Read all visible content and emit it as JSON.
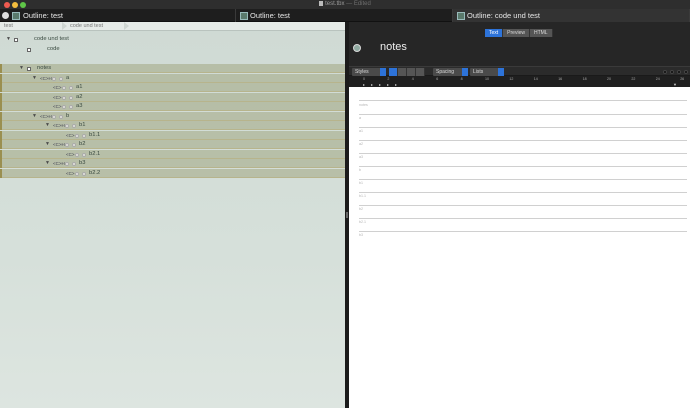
{
  "window": {
    "filename": "test.tbx",
    "status": "— Edited"
  },
  "tabs": [
    {
      "label": "Outline: test"
    },
    {
      "label": "Outline: test"
    },
    {
      "label": "Outline: code und test"
    }
  ],
  "breadcrumb": [
    "test",
    "code und test"
  ],
  "outline": [
    {
      "label": "code und test",
      "level": 0,
      "selected": false,
      "expanded": true,
      "tag": ""
    },
    {
      "label": "code",
      "level": 1,
      "selected": false,
      "expanded": false,
      "tag": ""
    },
    {
      "label": "notes",
      "level": 1,
      "selected": true,
      "expanded": true,
      "tag": ""
    },
    {
      "label": "a",
      "level": 2,
      "selected": true,
      "expanded": true,
      "tag": "<C>H"
    },
    {
      "label": "a1",
      "level": 3,
      "selected": true,
      "expanded": false,
      "tag": "<C>"
    },
    {
      "label": "a2",
      "level": 3,
      "selected": true,
      "expanded": false,
      "tag": "<C>"
    },
    {
      "label": "a3",
      "level": 3,
      "selected": true,
      "expanded": false,
      "tag": "<C>"
    },
    {
      "label": "b",
      "level": 2,
      "selected": true,
      "expanded": true,
      "tag": "<C>H"
    },
    {
      "label": "b1",
      "level": 3,
      "selected": true,
      "expanded": true,
      "tag": "<C>H"
    },
    {
      "label": "b1.1",
      "level": 4,
      "selected": true,
      "expanded": false,
      "tag": "<C>"
    },
    {
      "label": "b2",
      "level": 3,
      "selected": true,
      "expanded": true,
      "tag": "<C>H"
    },
    {
      "label": "b2.1",
      "level": 4,
      "selected": true,
      "expanded": false,
      "tag": "<C>"
    },
    {
      "label": "b3",
      "level": 3,
      "selected": true,
      "expanded": true,
      "tag": "<C>H"
    },
    {
      "label": "b2.2",
      "level": 4,
      "selected": true,
      "expanded": false,
      "tag": "<C>"
    }
  ],
  "editor": {
    "mode_tabs": [
      "Text",
      "Preview",
      "HTML"
    ],
    "active_mode": "Text",
    "note_title": "notes",
    "toolbar": {
      "styles": "Styles",
      "spacing": "Spacing",
      "lists": "Lists"
    },
    "ruler_ticks": [
      "0",
      "2",
      "4",
      "6",
      "8",
      "10",
      "12",
      "14",
      "16",
      "18",
      "20",
      "22",
      "24",
      "26"
    ],
    "text_lines": [
      "notes",
      "a",
      "a1",
      "a2",
      "a3",
      "b",
      "b1",
      "b1.1",
      "b2",
      "b2.1",
      "b3"
    ]
  },
  "colors": {
    "accent": "#2d73d9",
    "outline_bg": "#d3ddd7",
    "selection": "#b0ad86"
  }
}
